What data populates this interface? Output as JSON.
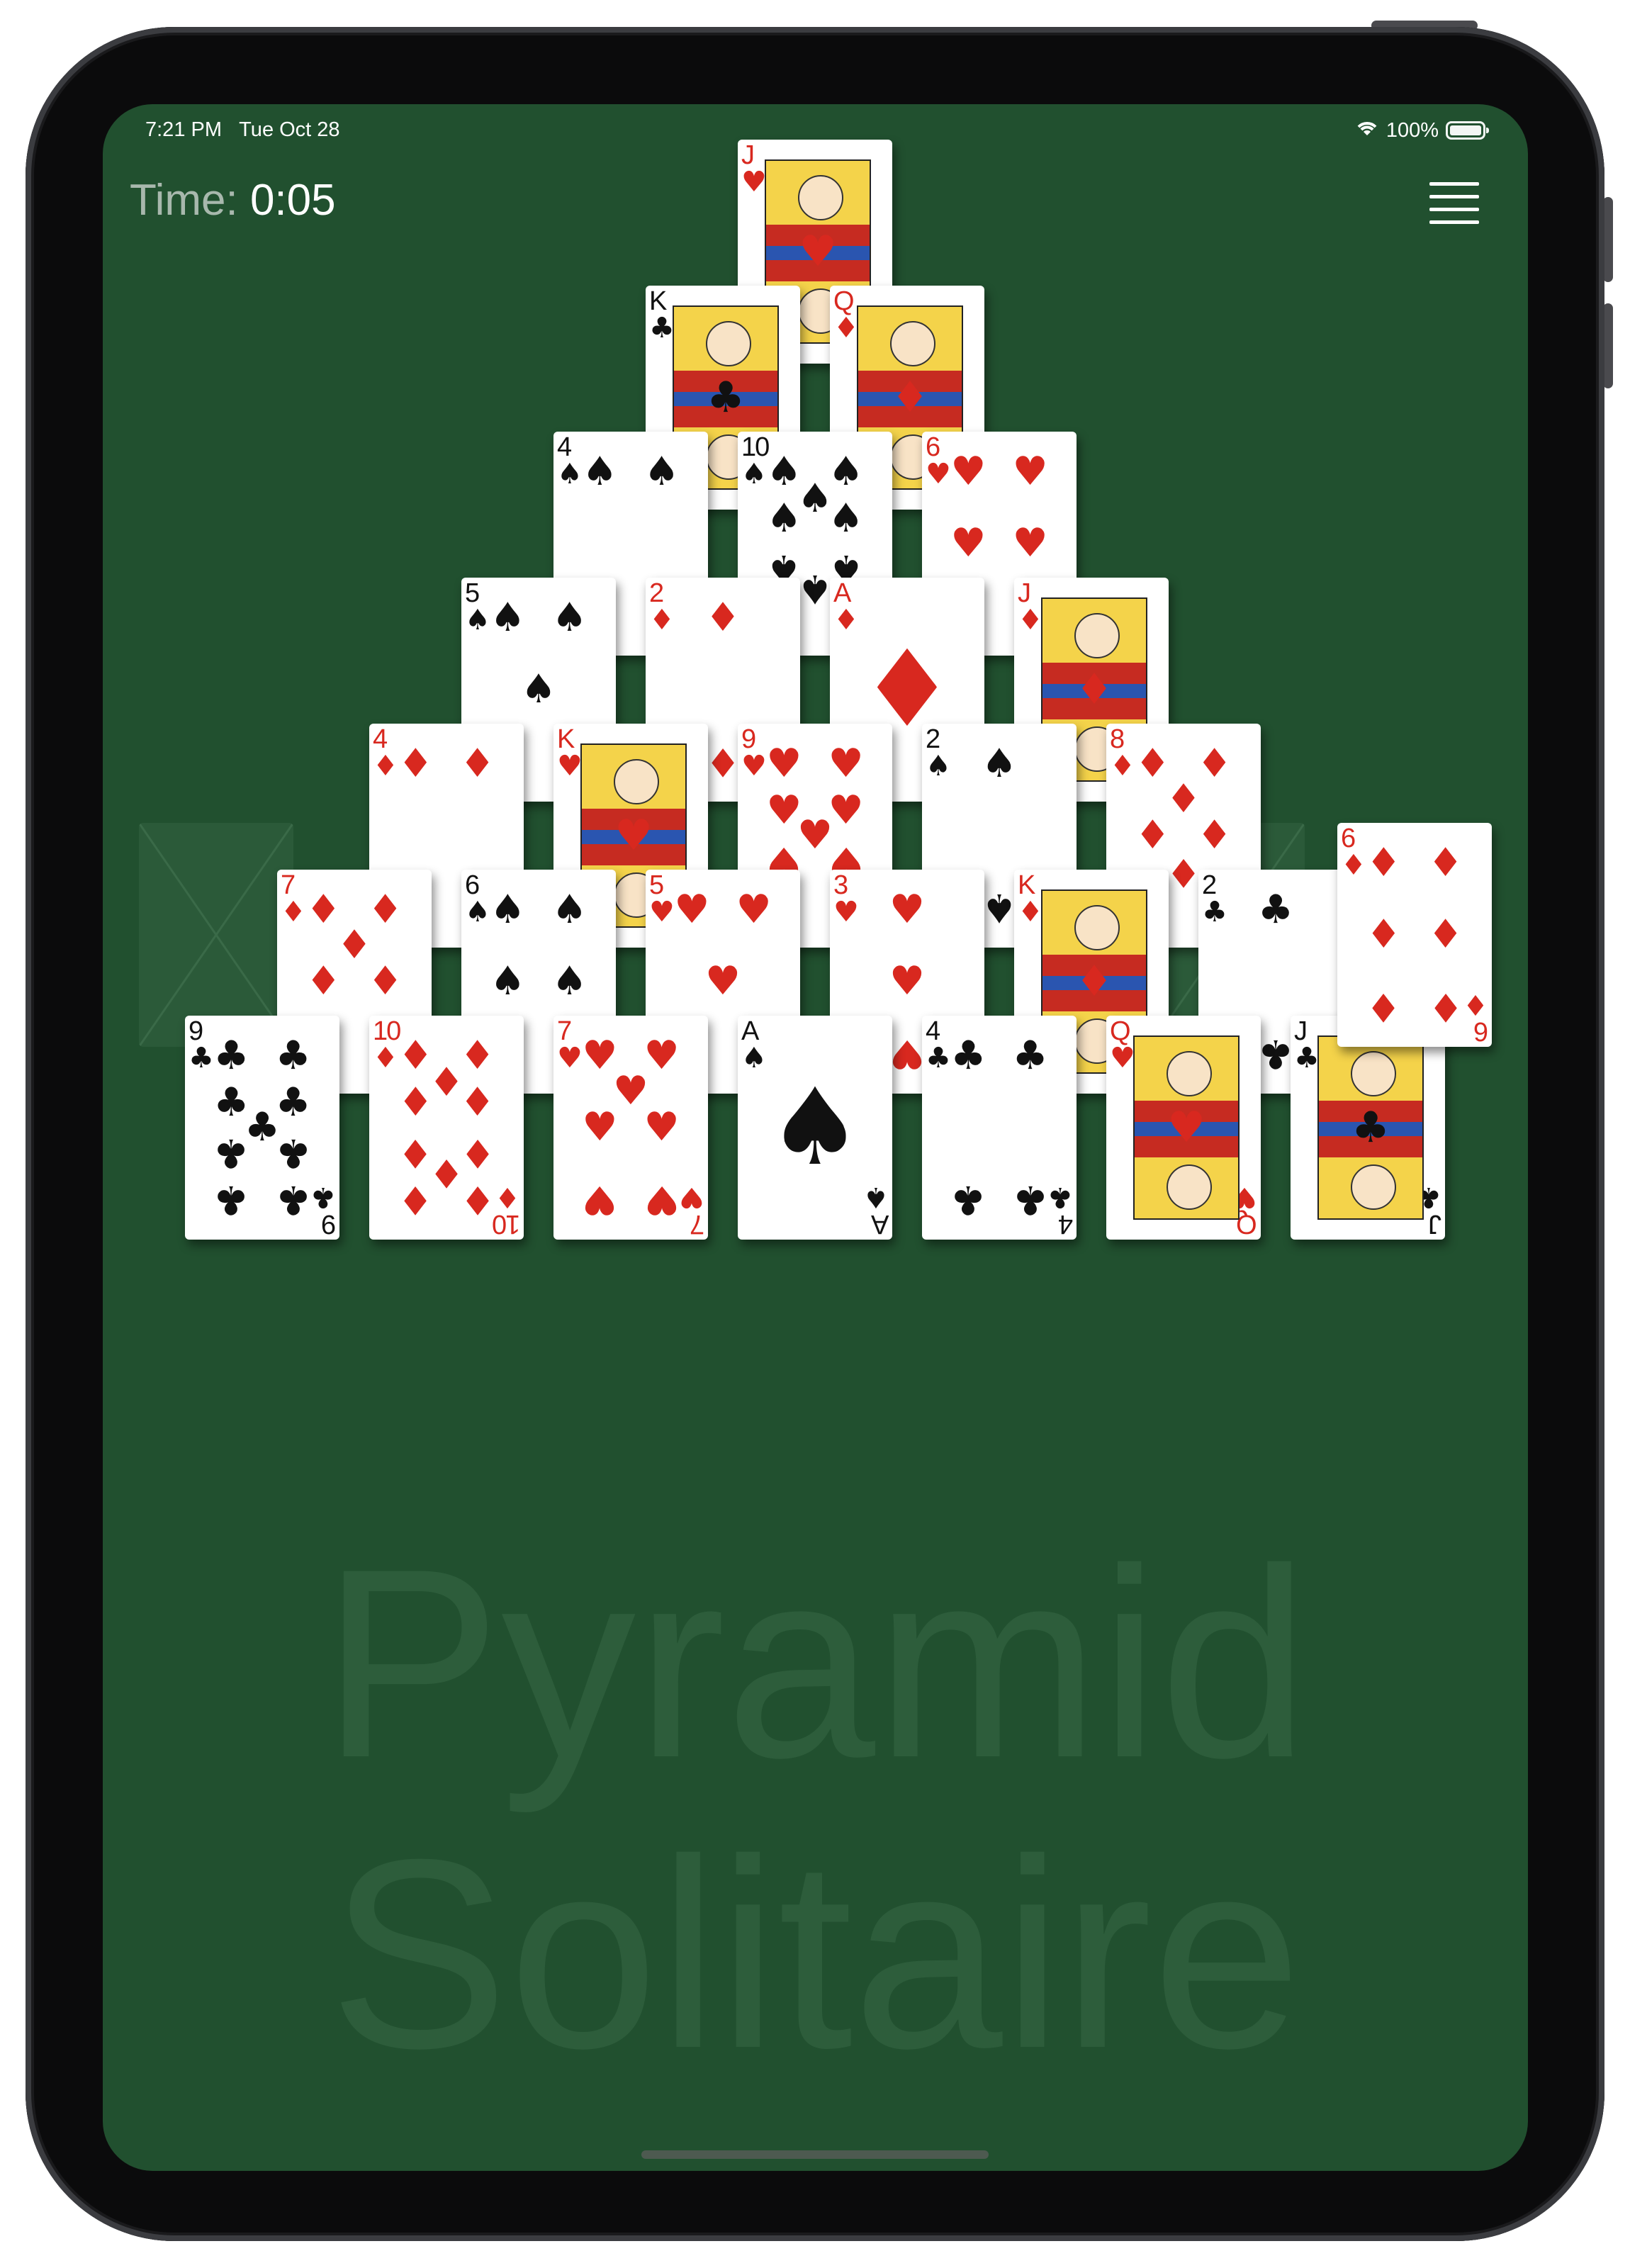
{
  "status_bar": {
    "time": "7:21 PM",
    "date": "Tue Oct 28",
    "battery": "100%"
  },
  "timer": {
    "label": "Time:",
    "value": "0:05"
  },
  "watermark": {
    "line1": "Pyramid",
    "line2": "Solitaire"
  },
  "pyramid": [
    [
      {
        "rank": "J",
        "suit": "♥"
      }
    ],
    [
      {
        "rank": "K",
        "suit": "♣"
      },
      {
        "rank": "Q",
        "suit": "♦"
      }
    ],
    [
      {
        "rank": "4",
        "suit": "♠"
      },
      {
        "rank": "10",
        "suit": "♠"
      },
      {
        "rank": "6",
        "suit": "♥"
      }
    ],
    [
      {
        "rank": "5",
        "suit": "♠"
      },
      {
        "rank": "2",
        "suit": "♦"
      },
      {
        "rank": "A",
        "suit": "♦"
      },
      {
        "rank": "J",
        "suit": "♦"
      }
    ],
    [
      {
        "rank": "4",
        "suit": "♦"
      },
      {
        "rank": "K",
        "suit": "♥"
      },
      {
        "rank": "9",
        "suit": "♥"
      },
      {
        "rank": "2",
        "suit": "♠"
      },
      {
        "rank": "8",
        "suit": "♦"
      }
    ],
    [
      {
        "rank": "7",
        "suit": "♦"
      },
      {
        "rank": "6",
        "suit": "♠"
      },
      {
        "rank": "5",
        "suit": "♥"
      },
      {
        "rank": "3",
        "suit": "♥"
      },
      {
        "rank": "K",
        "suit": "♦"
      },
      {
        "rank": "2",
        "suit": "♣"
      }
    ],
    [
      {
        "rank": "9",
        "suit": "♣"
      },
      {
        "rank": "10",
        "suit": "♦"
      },
      {
        "rank": "7",
        "suit": "♥"
      },
      {
        "rank": "A",
        "suit": "♠"
      },
      {
        "rank": "4",
        "suit": "♣"
      },
      {
        "rank": "Q",
        "suit": "♥"
      },
      {
        "rank": "J",
        "suit": "♣"
      }
    ]
  ],
  "waste_card": {
    "rank": "6",
    "suit": "♦"
  },
  "colors": {
    "felt": "#21502f",
    "red": "#d8281f",
    "black": "#111111"
  }
}
